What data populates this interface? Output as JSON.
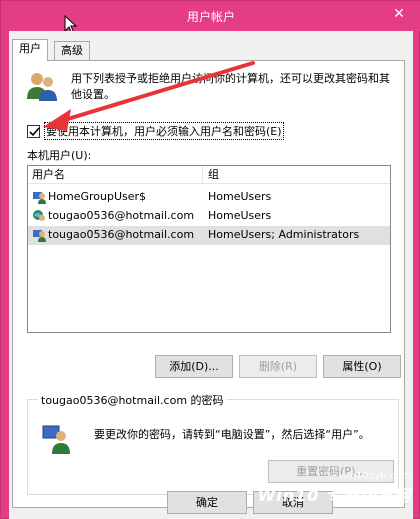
{
  "window": {
    "title": "用户帐户",
    "close_glyph": "✕"
  },
  "tabs": [
    {
      "label": "用户",
      "active": true
    },
    {
      "label": "高级",
      "active": false
    }
  ],
  "intro_text": "用下列表授予或拒绝用户访问你的计算机，还可以更改其密码和其他设置。",
  "require_login": {
    "label": "要使用本计算机，用户必须输入用户名和密码(E)",
    "checked": true
  },
  "local_users_label": "本机用户(U):",
  "users_table": {
    "columns": [
      "用户名",
      "组"
    ],
    "rows": [
      {
        "name": "HomeGroupUser$",
        "group": "HomeUsers",
        "icon": "user-icon",
        "selected": false
      },
      {
        "name": "tougao0536@hotmail.com",
        "group": "HomeUsers",
        "icon": "microsoft-account-icon",
        "selected": false
      },
      {
        "name": "tougao0536@hotmail.com",
        "group": "HomeUsers; Administrators",
        "icon": "user-icon",
        "selected": true
      }
    ]
  },
  "buttons": {
    "add": "添加(D)...",
    "remove": "删除(R)",
    "properties": "属性(O)"
  },
  "password_group": {
    "title": "tougao0536@hotmail.com 的密码",
    "text": "要更改你的密码，请转到“电脑设置”，然后选择“用户”。",
    "reset_label": "重置密码(P)..."
  },
  "dialog_buttons": {
    "ok": "确定",
    "cancel": "取消"
  },
  "watermark": {
    "url": "win10zyb.com",
    "logo": "Win10 专业版官网"
  },
  "colors": {
    "titlebar": "#e53c87",
    "annotation_arrow": "#e8333a"
  }
}
